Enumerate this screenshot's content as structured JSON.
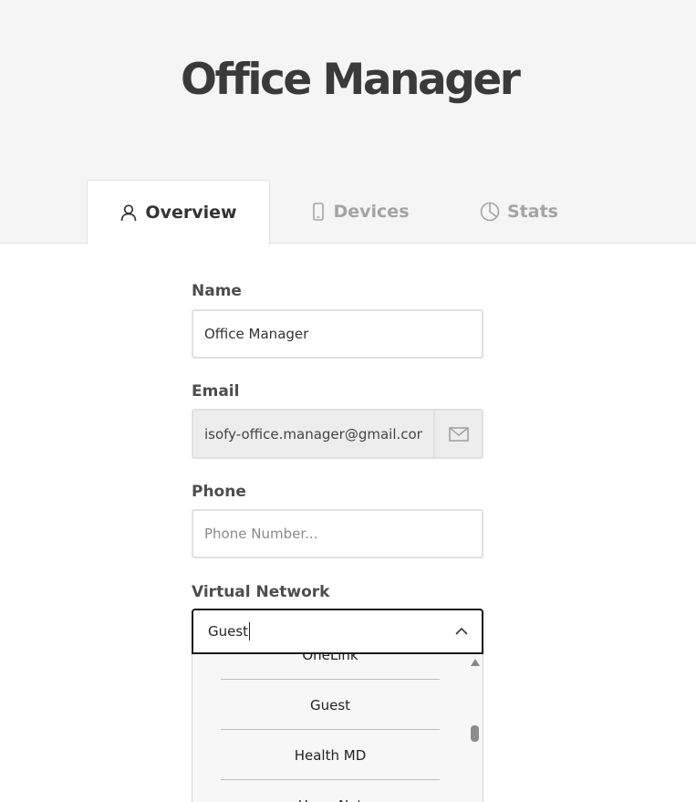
{
  "page": {
    "title": "Office Manager"
  },
  "tabs": [
    {
      "label": "Overview",
      "icon": "user-icon",
      "active": true
    },
    {
      "label": "Devices",
      "icon": "phone-icon",
      "active": false
    },
    {
      "label": "Stats",
      "icon": "pie-chart-icon",
      "active": false
    }
  ],
  "form": {
    "name": {
      "label": "Name",
      "value": "Office Manager"
    },
    "email": {
      "label": "Email",
      "value": "isofy-office.manager@gmail.com",
      "addon_icon": "envelope-icon"
    },
    "phone": {
      "label": "Phone",
      "placeholder": "Phone Number..."
    },
    "virtual_network": {
      "label": "Virtual Network",
      "typed_value": "Guest",
      "options": [
        "OneLink",
        "Guest",
        "Health MD",
        "HomeNet"
      ]
    }
  },
  "colors": {
    "header_bg": "#f5f5f5",
    "active_tab_text": "#333333",
    "inactive_tab_text": "#a4a4a4",
    "focus_border": "#1a1a1a",
    "dropdown_bg": "#f7f7f7"
  }
}
